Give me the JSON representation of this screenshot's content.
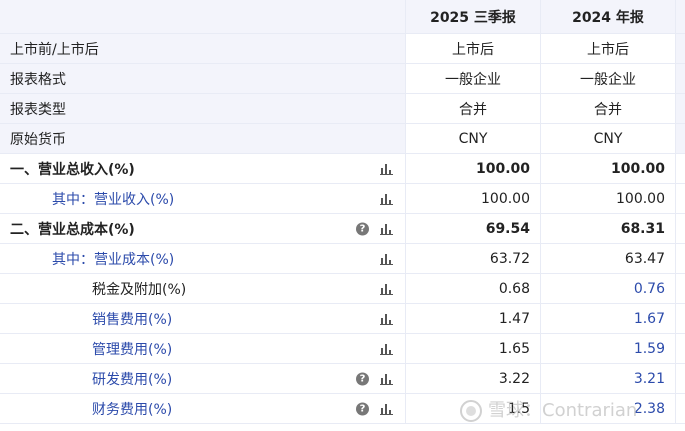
{
  "header": {
    "col1": "2025 三季报",
    "col2": "2024 年报"
  },
  "info_rows": [
    {
      "label": "上市前/上市后",
      "v1": "上市后",
      "v2": "上市后"
    },
    {
      "label": "报表格式",
      "v1": "一般企业",
      "v2": "一般企业"
    },
    {
      "label": "报表类型",
      "v1": "合并",
      "v2": "合并"
    },
    {
      "label": "原始货币",
      "v1": "CNY",
      "v2": "CNY"
    }
  ],
  "rows": {
    "r0": {
      "label": "一、营业总收入(%)",
      "v1": "100.00",
      "v2": "100.00"
    },
    "r1": {
      "label": "其中：营业收入(%)",
      "v1": "100.00",
      "v2": "100.00"
    },
    "r2": {
      "label": "二、营业总成本(%)",
      "v1": "69.54",
      "v2": "68.31"
    },
    "r3": {
      "label": "其中：营业成本(%)",
      "v1": "63.72",
      "v2": "63.47"
    },
    "r4": {
      "label": "税金及附加(%)",
      "v1": "0.68",
      "v2": "0.76"
    },
    "r5": {
      "label": "销售费用(%)",
      "v1": "1.47",
      "v2": "1.67"
    },
    "r6": {
      "label": "管理费用(%)",
      "v1": "1.65",
      "v2": "1.59"
    },
    "r7": {
      "label": "研发费用(%)",
      "v1": "3.22",
      "v2": "3.21"
    },
    "r8": {
      "label": "财务费用(%)",
      "v1": "1.5",
      "v2": "2.38"
    }
  },
  "icons": {
    "help": "help-icon",
    "chart": "bar-chart-icon",
    "help_glyph": "?"
  },
  "watermark": {
    "text": "雪球：Contrarian"
  },
  "colors": {
    "header_bg": "#f3f4fb",
    "link_blue": "#2c4bab",
    "border": "#e8ebf5"
  }
}
